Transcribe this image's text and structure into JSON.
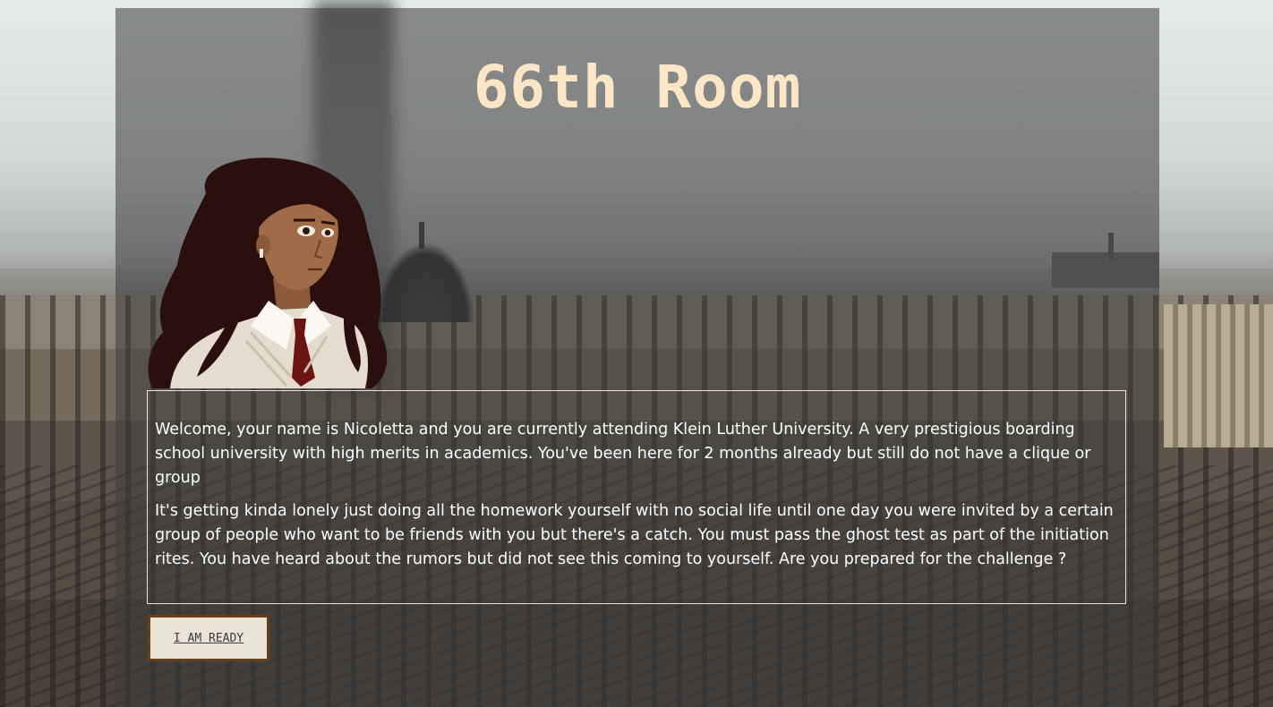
{
  "game": {
    "title": "66th Room",
    "character_name": "Nicoletta"
  },
  "story": {
    "paragraphs": [
      "Welcome, your name is Nicoletta and you are currently attending Klein Luther University. A very prestigious boarding school university with high merits in academics. You've been here for 2 months already but still do not have a clique or group",
      "It's getting kinda lonely just doing all the homework yourself with no social life until one day you were invited by a certain group of people who want to be friends with you but there's a catch. You must pass the ghost test as part of the initiation rites. You have heard about the rumors but did not see this coming to yourself. Are you prepared for the challenge ?"
    ]
  },
  "actions": {
    "ready_label": "I AM READY"
  },
  "colors": {
    "title": "#fde6c6",
    "panel_overlay": "rgba(60,60,60,0.55)",
    "story_border": "#efe3c8",
    "button_bg": "#e9e4d6",
    "button_border": "#6b3e16"
  }
}
